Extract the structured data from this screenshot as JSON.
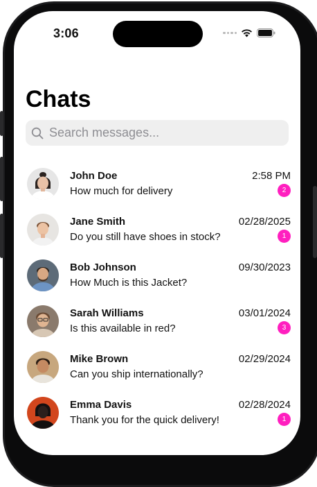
{
  "status_bar": {
    "time": "3:06"
  },
  "header": {
    "title": "Chats"
  },
  "search": {
    "placeholder": "Search messages..."
  },
  "chats": [
    {
      "name": "John Doe",
      "message": "How much for delivery",
      "date": "2:58 PM",
      "unread": "2"
    },
    {
      "name": "Jane Smith",
      "message": "Do you still have shoes in stock?",
      "date": "02/28/2025",
      "unread": "1"
    },
    {
      "name": "Bob Johnson",
      "message": "How Much is this Jacket?",
      "date": "09/30/2023",
      "unread": ""
    },
    {
      "name": "Sarah Williams",
      "message": "Is this available in red?",
      "date": "03/01/2024",
      "unread": "3"
    },
    {
      "name": "Mike Brown",
      "message": "Can you ship internationally?",
      "date": "02/29/2024",
      "unread": ""
    },
    {
      "name": "Emma Davis",
      "message": "Thank you for the quick delivery!",
      "date": "02/28/2024",
      "unread": "1"
    }
  ],
  "colors": {
    "badge": "#ff1fbf",
    "search_bg": "#efefef"
  },
  "icons": {
    "search": "search-icon",
    "wifi": "wifi-icon",
    "battery": "battery-icon",
    "signal": "signal-icon"
  }
}
